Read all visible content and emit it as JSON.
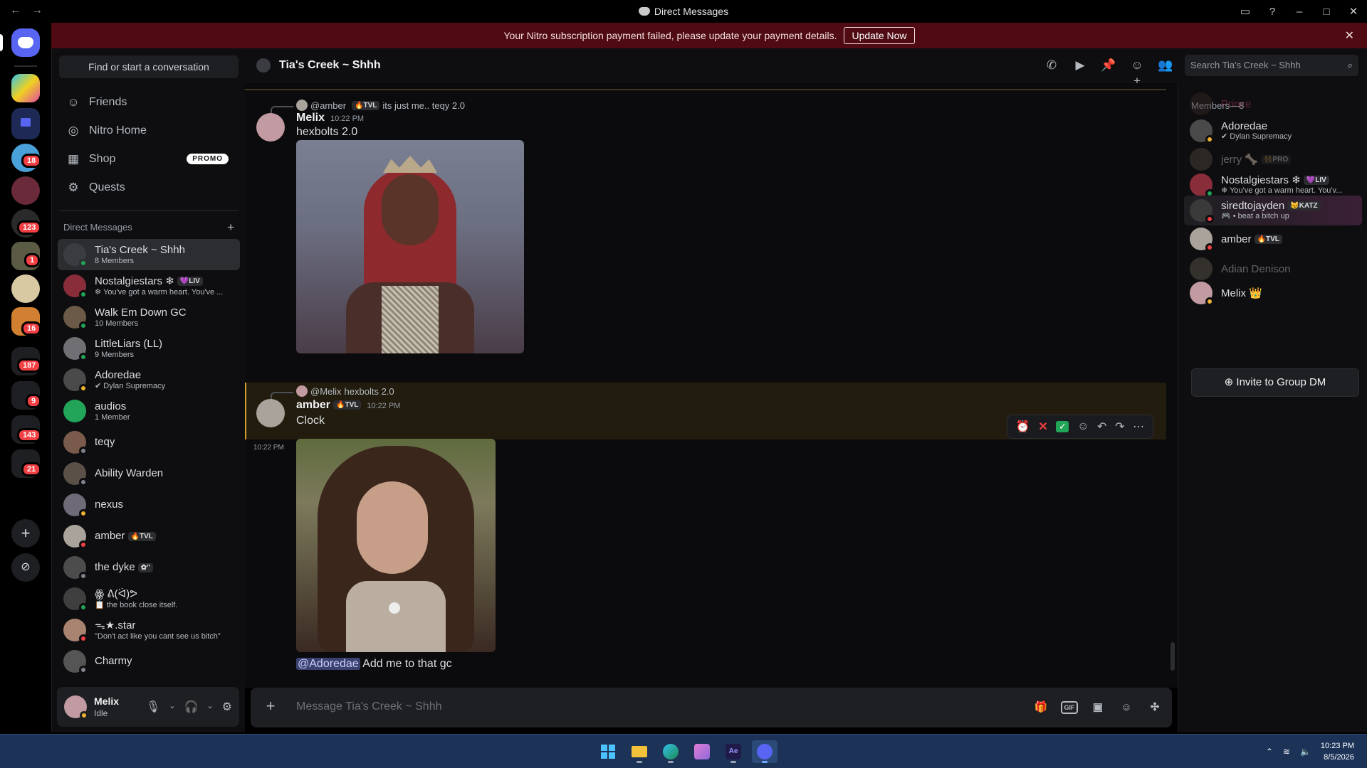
{
  "window": {
    "title": "Direct Messages",
    "back": "←",
    "forward": "→"
  },
  "banner": {
    "text": "Your Nitro subscription payment failed, please update your payment details.",
    "button": "Update Now"
  },
  "rail_badges": [
    "18",
    "123",
    "1",
    "16",
    "187",
    "9",
    "143",
    "21"
  ],
  "sidebar": {
    "find": "Find or start a conversation",
    "nav": [
      {
        "label": "Friends",
        "icon": "friends-icon"
      },
      {
        "label": "Nitro Home",
        "icon": "nitro-icon"
      },
      {
        "label": "Shop",
        "icon": "shop-icon",
        "badge": "PROMO"
      },
      {
        "label": "Quests",
        "icon": "quests-icon"
      }
    ],
    "dm_header": "Direct Messages",
    "dms": [
      {
        "name": "Tia's Creek ~ Shhh",
        "sub": "8 Members",
        "color": "#3a3c42"
      },
      {
        "name": "Nostalgiestars ❄",
        "tag": "💜LIV",
        "sub": "❄ You've got a warm heart. You've ...",
        "color": "#8a2d3a"
      },
      {
        "name": "Walk Em Down GC",
        "sub": "10 Members",
        "color": "#6b5a48"
      },
      {
        "name": "LittleLiars (LL)",
        "sub": "9 Members",
        "color": "#6f6f74"
      },
      {
        "name": "Adoredae",
        "sub": "✔ Dylan Supremacy",
        "color": "#4a4a4a"
      },
      {
        "name": "audios",
        "sub": "1 Member",
        "color": "#23a559"
      },
      {
        "name": "teqy",
        "sub": "",
        "color": "#7a5a4a"
      },
      {
        "name": "Ability Warden",
        "sub": "",
        "color": "#5a5047"
      },
      {
        "name": "nexus",
        "sub": "",
        "color": "#6e6a78"
      },
      {
        "name": "amber",
        "tag": "🔥TVL",
        "sub": "",
        "color": "#a9a39b"
      },
      {
        "name": "the dyke",
        "tag": "✿\"",
        "sub": "",
        "color": "#4c4c4c"
      },
      {
        "name": "ꙮ ᕕ(ᐛ)ᕗ",
        "sub": "📋 the book close itself.",
        "color": "#3f3f3f"
      },
      {
        "name": "ᯓ★.star",
        "sub": "\"Don't act like you cant see us bitch\"",
        "color": "#a88470"
      },
      {
        "name": "Charmy",
        "sub": "",
        "color": "#555"
      }
    ]
  },
  "user": {
    "name": "Melix",
    "status": "Idle"
  },
  "chat": {
    "channel": "Tia's Creek ~ Shhh",
    "search_placeholder": "Search Tia's Creek ~ Shhh",
    "messages": [
      {
        "reply_to": "@amber",
        "reply_tag": "🔥TVL",
        "reply_text": "its just me.. teqy 2.0",
        "author": "Melix",
        "time": "10:22 PM",
        "text": "hexbolts 2.0"
      },
      {
        "reply_to": "@Melix",
        "reply_text": "hexbolts 2.0",
        "author": "amber",
        "author_tag": "🔥TVL",
        "time": "10:22 PM",
        "text": "Clock"
      },
      {
        "time": "10:22 PM",
        "mention": "@Adoredae",
        "text": " Add me to that gc"
      }
    ],
    "composer_placeholder": "Message Tia's Creek ~ Shhh"
  },
  "members": {
    "header": "Members—8",
    "list": [
      {
        "name": "Prince",
        "sub": "",
        "color": "#3a2a28",
        "name_color": "#e0457b",
        "dim": true
      },
      {
        "name": "Adoredae",
        "sub": "✔ Dylan Supremacy",
        "color": "#4a4a4a"
      },
      {
        "name": "jerry 🦴",
        "tag": "👯PRO",
        "sub": "",
        "color": "#5a4d45",
        "dim": true
      },
      {
        "name": "Nostalgiestars ❄",
        "tag": "💜LIV",
        "sub": "❄ You've got a warm heart. You'v...",
        "color": "#8a2d3a"
      },
      {
        "name": "siredtojayden",
        "tag": "😼KATZ",
        "sub": "🎮 • beat a bitch up",
        "color": "#3a3a3a",
        "highlight": true
      },
      {
        "name": "amber",
        "tag": "🔥TVL",
        "sub": "",
        "color": "#a9a39b"
      },
      {
        "name": "Adian Denison",
        "sub": "",
        "color": "#6e6454",
        "dim": true
      },
      {
        "name": "Melix 👑",
        "sub": "",
        "color": "#c29aa1"
      }
    ],
    "invite": "Invite to Group DM"
  },
  "taskbar": {
    "time": "10:23 PM",
    "date": "8/5/2026"
  }
}
